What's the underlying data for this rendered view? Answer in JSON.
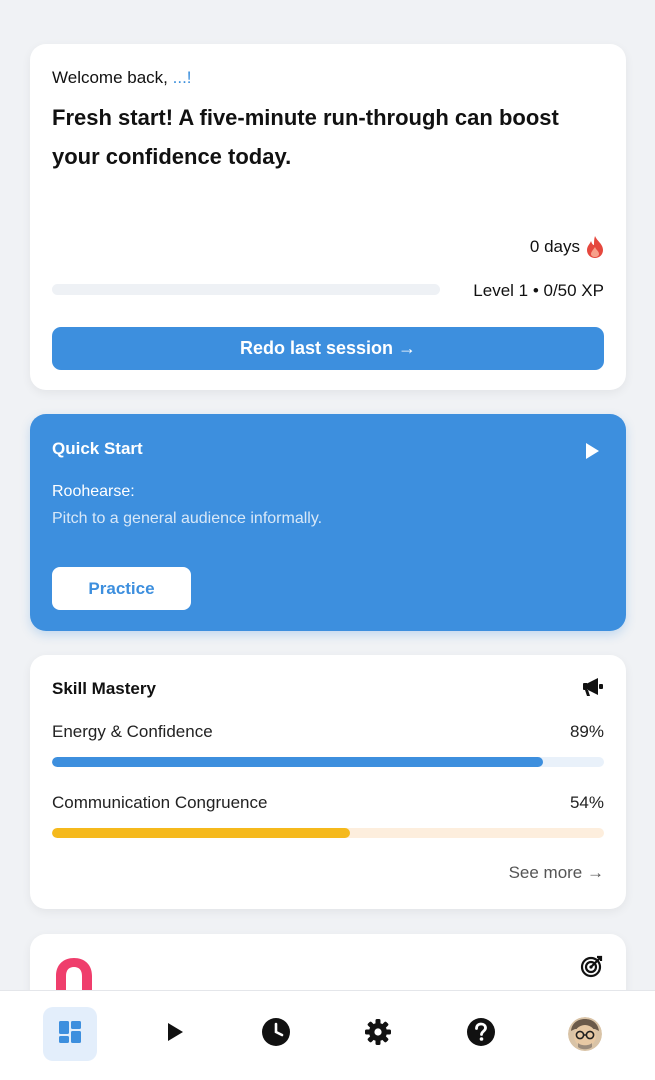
{
  "welcome": {
    "greeting": "Welcome back, ",
    "name": "...!",
    "headline": "Fresh start! A five-minute run-through can boost your confidence today.",
    "streak": "0 days",
    "level": "Level 1 • 0/50 XP",
    "xp_progress": 0,
    "redo_button": "Redo last session →"
  },
  "quick_start": {
    "title": "Quick Start",
    "label": "Roohearse:",
    "description": "Pitch to a general audience informally.",
    "practice_button": "Practice"
  },
  "skill_mastery": {
    "title": "Skill Mastery",
    "skills": [
      {
        "name": "Energy & Confidence",
        "percent_label": "89%",
        "value": 0.89,
        "color": "#3d8fde",
        "track_color": "#e9f1fa"
      },
      {
        "name": "Communication Congruence",
        "percent_label": "54%",
        "value": 0.54,
        "color": "#f5b91c",
        "track_color": "#fdeedd"
      }
    ],
    "see_more": "See more →"
  },
  "colors": {
    "accent": "#3d8fde",
    "streak_flame": "#e5483e",
    "goal_pink": "#ef3e6c"
  },
  "nav": {
    "items": [
      {
        "icon": "dashboard-icon",
        "active": true
      },
      {
        "icon": "play-icon",
        "active": false
      },
      {
        "icon": "history-icon",
        "active": false
      },
      {
        "icon": "gear-icon",
        "active": false
      },
      {
        "icon": "help-icon",
        "active": false
      },
      {
        "icon": "avatar",
        "active": false
      }
    ]
  }
}
